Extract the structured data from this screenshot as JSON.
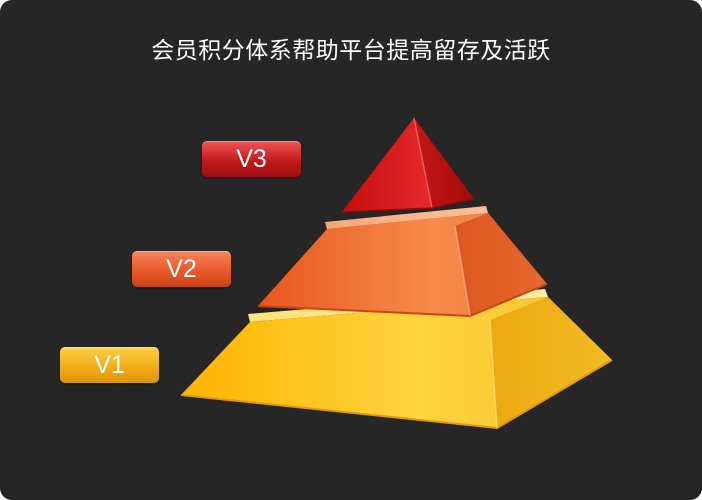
{
  "title": "会员积分体系帮助平台提高留存及活跃",
  "levels": [
    {
      "label": "V3",
      "tier": "top",
      "color": "#d01818"
    },
    {
      "label": "V2",
      "tier": "middle",
      "color": "#ee6a32"
    },
    {
      "label": "V1",
      "tier": "bottom",
      "color": "#f7c22c"
    }
  ],
  "colors": {
    "background": "#262626",
    "title_text": "#ffffff"
  }
}
